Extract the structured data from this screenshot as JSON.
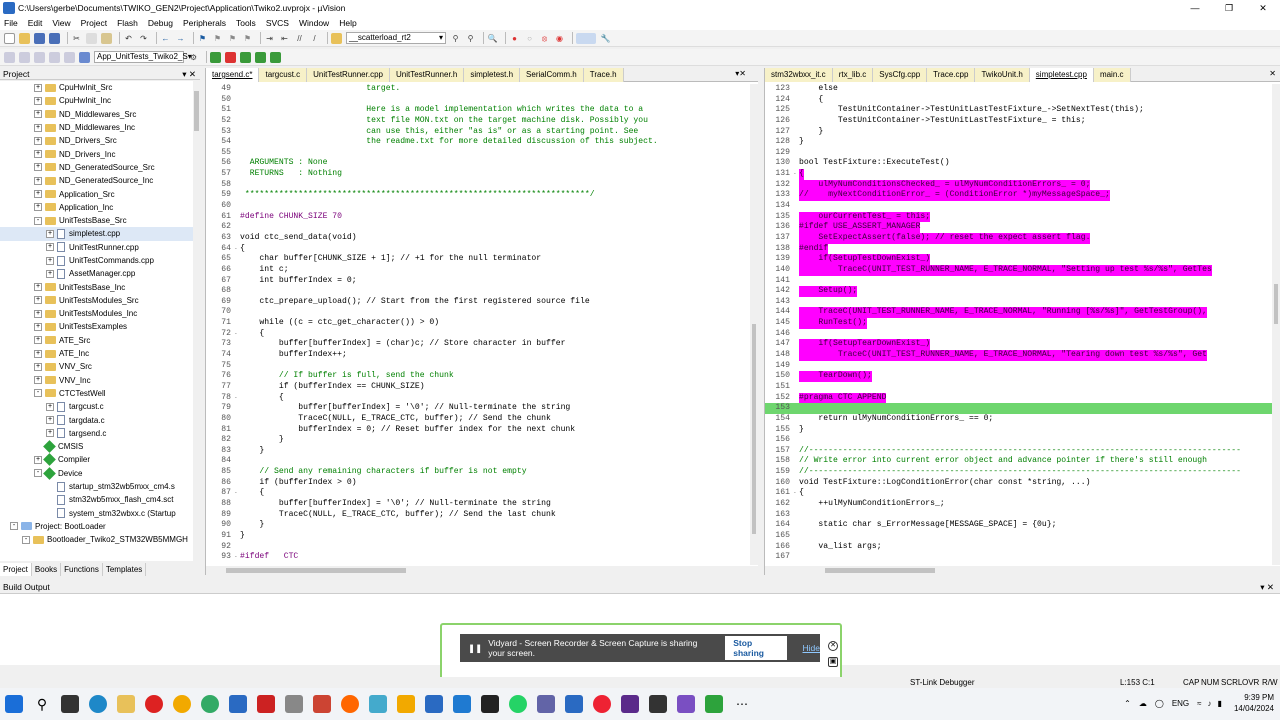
{
  "window": {
    "title": "C:\\Users\\gerbe\\Documents\\TWIKO_GEN2\\Project\\Application\\Twiko2.uvprojx - µVision"
  },
  "menu": [
    "File",
    "Edit",
    "View",
    "Project",
    "Flash",
    "Debug",
    "Peripherals",
    "Tools",
    "SVCS",
    "Window",
    "Help"
  ],
  "toolbar": {
    "target_combo": "__scatterload_rt2",
    "project_combo": "App_UnitTests_Twiko2_S"
  },
  "project_panel": {
    "title": "Project",
    "items": [
      {
        "label": "CpuHwInit_Src",
        "depth": 3,
        "type": "folder",
        "exp": "+"
      },
      {
        "label": "CpuHwInit_Inc",
        "depth": 3,
        "type": "folder",
        "exp": "+"
      },
      {
        "label": "ND_Middlewares_Src",
        "depth": 3,
        "type": "folder",
        "exp": "+"
      },
      {
        "label": "ND_Middlewares_Inc",
        "depth": 3,
        "type": "folder",
        "exp": "+"
      },
      {
        "label": "ND_Drivers_Src",
        "depth": 3,
        "type": "folder",
        "exp": "+"
      },
      {
        "label": "ND_Drivers_Inc",
        "depth": 3,
        "type": "folder",
        "exp": "+"
      },
      {
        "label": "ND_GeneratedSource_Src",
        "depth": 3,
        "type": "folder",
        "exp": "+"
      },
      {
        "label": "ND_GeneratedSource_Inc",
        "depth": 3,
        "type": "folder",
        "exp": "+"
      },
      {
        "label": "Application_Src",
        "depth": 3,
        "type": "folder",
        "exp": "+"
      },
      {
        "label": "Application_Inc",
        "depth": 3,
        "type": "folder",
        "exp": "+"
      },
      {
        "label": "UnitTestsBase_Src",
        "depth": 3,
        "type": "folder",
        "exp": "-"
      },
      {
        "label": "simpletest.cpp",
        "depth": 4,
        "type": "file",
        "exp": "+",
        "sel": true
      },
      {
        "label": "UnitTestRunner.cpp",
        "depth": 4,
        "type": "file",
        "exp": "+"
      },
      {
        "label": "UnitTestCommands.cpp",
        "depth": 4,
        "type": "file",
        "exp": "+"
      },
      {
        "label": "AssetManager.cpp",
        "depth": 4,
        "type": "file",
        "exp": "+"
      },
      {
        "label": "UnitTestsBase_Inc",
        "depth": 3,
        "type": "folder",
        "exp": "+"
      },
      {
        "label": "UnitTestsModules_Src",
        "depth": 3,
        "type": "folder",
        "exp": "+"
      },
      {
        "label": "UnitTestsModules_Inc",
        "depth": 3,
        "type": "folder",
        "exp": "+"
      },
      {
        "label": "UnitTestsExamples",
        "depth": 3,
        "type": "folder",
        "exp": "+"
      },
      {
        "label": "ATE_Src",
        "depth": 3,
        "type": "folder",
        "exp": "+"
      },
      {
        "label": "ATE_Inc",
        "depth": 3,
        "type": "folder",
        "exp": "+"
      },
      {
        "label": "VNV_Src",
        "depth": 3,
        "type": "folder",
        "exp": "+"
      },
      {
        "label": "VNV_Inc",
        "depth": 3,
        "type": "folder",
        "exp": "+"
      },
      {
        "label": "CTCTestWell",
        "depth": 3,
        "type": "folder",
        "exp": "-"
      },
      {
        "label": "targcust.c",
        "depth": 4,
        "type": "file",
        "exp": "+"
      },
      {
        "label": "targdata.c",
        "depth": 4,
        "type": "file",
        "exp": "+"
      },
      {
        "label": "targsend.c",
        "depth": 4,
        "type": "file",
        "exp": "+"
      },
      {
        "label": "CMSIS",
        "depth": 3,
        "type": "gem",
        "exp": ""
      },
      {
        "label": "Compiler",
        "depth": 3,
        "type": "gem",
        "exp": "+"
      },
      {
        "label": "Device",
        "depth": 3,
        "type": "gem",
        "exp": "-"
      },
      {
        "label": "startup_stm32wb5mxx_cm4.s",
        "depth": 4,
        "type": "file",
        "exp": ""
      },
      {
        "label": "stm32wb5mxx_flash_cm4.sct",
        "depth": 4,
        "type": "file",
        "exp": ""
      },
      {
        "label": "system_stm32wbxx.c (Startup",
        "depth": 4,
        "type": "file",
        "exp": ""
      },
      {
        "label": "Project: BootLoader",
        "depth": 1,
        "type": "proj",
        "exp": "-"
      },
      {
        "label": "Bootloader_Twiko2_STM32WB5MMGH",
        "depth": 2,
        "type": "folder",
        "exp": "-"
      }
    ],
    "tabs": [
      "Project",
      "Books",
      "Functions",
      "Templates"
    ]
  },
  "left_editor": {
    "tabs": [
      "targsend.c*",
      "targcust.c",
      "UnitTestRunner.cpp",
      "UnitTestRunner.h",
      "simpletest.h",
      "SerialComm.h",
      "Trace.h"
    ],
    "lines": [
      {
        "n": "49",
        "g": "",
        "html": "                          target."
      },
      {
        "n": "50",
        "g": "",
        "html": ""
      },
      {
        "n": "51",
        "g": "",
        "html": "                          Here is a model implementation which writes the data to a"
      },
      {
        "n": "52",
        "g": "",
        "html": "                          text file MON.txt on the target machine disk. Possibly you"
      },
      {
        "n": "53",
        "g": "",
        "html": "                          can use this, either \"as is\" or as a starting point. See"
      },
      {
        "n": "54",
        "g": "",
        "html": "                          the readme.txt for more detailed discussion of this subject."
      },
      {
        "n": "55",
        "g": "",
        "html": ""
      },
      {
        "n": "56",
        "g": "",
        "html": "  ARGUMENTS : None"
      },
      {
        "n": "57",
        "g": "",
        "html": "  RETURNS   : Nothing"
      },
      {
        "n": "58",
        "g": "",
        "html": ""
      },
      {
        "n": "59",
        "g": "",
        "html": " ***********************************************************************/"
      },
      {
        "n": "60",
        "g": "",
        "html": ""
      },
      {
        "n": "61",
        "g": "",
        "html": "#define CHUNK_SIZE 70",
        "cls": "pp"
      },
      {
        "n": "62",
        "g": "",
        "html": ""
      },
      {
        "n": "63",
        "g": "",
        "html": "void ctc_send_data(void)"
      },
      {
        "n": "64",
        "g": "-",
        "html": "{"
      },
      {
        "n": "65",
        "g": "",
        "html": "    char buffer[CHUNK_SIZE + 1]; // +1 for the null terminator"
      },
      {
        "n": "66",
        "g": "",
        "html": "    int c;"
      },
      {
        "n": "67",
        "g": "",
        "html": "    int bufferIndex = 0;"
      },
      {
        "n": "68",
        "g": "",
        "html": ""
      },
      {
        "n": "69",
        "g": "",
        "html": "    ctc_prepare_upload(); // Start from the first registered source file"
      },
      {
        "n": "70",
        "g": "",
        "html": ""
      },
      {
        "n": "71",
        "g": "",
        "html": "    while ((c = ctc_get_character()) > 0)"
      },
      {
        "n": "72",
        "g": "-",
        "html": "    {"
      },
      {
        "n": "73",
        "g": "",
        "html": "        buffer[bufferIndex] = (char)c; // Store character in buffer"
      },
      {
        "n": "74",
        "g": "",
        "html": "        bufferIndex++;"
      },
      {
        "n": "75",
        "g": "",
        "html": ""
      },
      {
        "n": "76",
        "g": "",
        "html": "        // If buffer is full, send the chunk"
      },
      {
        "n": "77",
        "g": "",
        "html": "        if (bufferIndex == CHUNK_SIZE)"
      },
      {
        "n": "78",
        "g": "-",
        "html": "        {"
      },
      {
        "n": "79",
        "g": "",
        "html": "            buffer[bufferIndex] = '\\0'; // Null-terminate the string"
      },
      {
        "n": "80",
        "g": "",
        "html": "            TraceC(NULL, E_TRACE_CTC, buffer); // Send the chunk"
      },
      {
        "n": "81",
        "g": "",
        "html": "            bufferIndex = 0; // Reset buffer index for the next chunk"
      },
      {
        "n": "82",
        "g": "",
        "html": "        }"
      },
      {
        "n": "83",
        "g": "",
        "html": "    }"
      },
      {
        "n": "84",
        "g": "",
        "html": ""
      },
      {
        "n": "85",
        "g": "",
        "html": "    // Send any remaining characters if buffer is not empty"
      },
      {
        "n": "86",
        "g": "",
        "html": "    if (bufferIndex > 0)"
      },
      {
        "n": "87",
        "g": "-",
        "html": "    {"
      },
      {
        "n": "88",
        "g": "",
        "html": "        buffer[bufferIndex] = '\\0'; // Null-terminate the string"
      },
      {
        "n": "89",
        "g": "",
        "html": "        TraceC(NULL, E_TRACE_CTC, buffer); // Send the last chunk"
      },
      {
        "n": "90",
        "g": "",
        "html": "    }"
      },
      {
        "n": "91",
        "g": "",
        "html": "}"
      },
      {
        "n": "92",
        "g": "",
        "html": ""
      },
      {
        "n": "93",
        "g": "-",
        "html": "#ifdef   CTC"
      }
    ]
  },
  "right_editor": {
    "tabs": [
      "stm32wbxx_it.c",
      "rtx_lib.c",
      "SysCfg.cpp",
      "Trace.cpp",
      "TwikoUnit.h",
      "simpletest.cpp",
      "main.c"
    ],
    "lines": [
      {
        "n": "123",
        "g": "",
        "html": "    else"
      },
      {
        "n": "124",
        "g": "",
        "html": "    {"
      },
      {
        "n": "125",
        "g": "",
        "html": "        TestUnitContainer->TestUnitLastTestFixture_->SetNextTest(this);"
      },
      {
        "n": "126",
        "g": "",
        "html": "        TestUnitContainer->TestUnitLastTestFixture_ = this;"
      },
      {
        "n": "127",
        "g": "",
        "html": "    }"
      },
      {
        "n": "128",
        "g": "",
        "html": "}"
      },
      {
        "n": "129",
        "g": "",
        "html": ""
      },
      {
        "n": "130",
        "g": "",
        "html": "bool TestFixture::ExecuteTest()"
      },
      {
        "n": "131",
        "g": "-",
        "html": "{",
        "m": "mag"
      },
      {
        "n": "132",
        "g": "",
        "html": "    ulMyNumConditionsChecked_ = ulMyNumConditionErrors_ = 0;",
        "m": "mag"
      },
      {
        "n": "133",
        "g": "",
        "html": "//    myNextConditionError_ = (ConditionError *)myMessageSpace_;",
        "m": "mag"
      },
      {
        "n": "134",
        "g": "",
        "html": ""
      },
      {
        "n": "135",
        "g": "",
        "html": "    ourCurrentTest_ = this;",
        "m": "mag"
      },
      {
        "n": "136",
        "g": "",
        "html": "#ifdef USE_ASSERT_MANAGER",
        "m": "mag"
      },
      {
        "n": "137",
        "g": "",
        "html": "    SetExpectAssert(false); // reset the expect assert flag.",
        "m": "mag"
      },
      {
        "n": "138",
        "g": "",
        "html": "#endif",
        "m": "mag"
      },
      {
        "n": "139",
        "g": "",
        "html": "    if(SetupTestDownExist_)",
        "m": "mag"
      },
      {
        "n": "140",
        "g": "",
        "html": "        TraceC(UNIT_TEST_RUNNER_NAME, E_TRACE_NORMAL, \"Setting up test %s/%s\", GetTes",
        "m": "mag"
      },
      {
        "n": "141",
        "g": "",
        "html": ""
      },
      {
        "n": "142",
        "g": "",
        "html": "    Setup();",
        "m": "mag"
      },
      {
        "n": "143",
        "g": "",
        "html": ""
      },
      {
        "n": "144",
        "g": "",
        "html": "    TraceC(UNIT_TEST_RUNNER_NAME, E_TRACE_NORMAL, \"Running [%s/%s]\", GetTestGroup(),",
        "m": "mag"
      },
      {
        "n": "145",
        "g": "",
        "html": "    RunTest();",
        "m": "mag"
      },
      {
        "n": "146",
        "g": "",
        "html": ""
      },
      {
        "n": "147",
        "g": "",
        "html": "    if(SetupTearDownExist_)",
        "m": "mag"
      },
      {
        "n": "148",
        "g": "",
        "html": "        TraceC(UNIT_TEST_RUNNER_NAME, E_TRACE_NORMAL, \"Tearing down test %s/%s\", Get",
        "m": "mag"
      },
      {
        "n": "149",
        "g": "",
        "html": ""
      },
      {
        "n": "150",
        "g": "",
        "html": "    TearDown();",
        "m": "mag"
      },
      {
        "n": "151",
        "g": "",
        "html": ""
      },
      {
        "n": "152",
        "g": "",
        "html": "#pragma CTC APPEND",
        "m": "mag"
      },
      {
        "n": "153",
        "g": "",
        "html": "",
        "m": "grn"
      },
      {
        "n": "154",
        "g": "",
        "html": "    return ulMyNumConditionErrors_ == 0;"
      },
      {
        "n": "155",
        "g": "",
        "html": "}"
      },
      {
        "n": "156",
        "g": "",
        "html": ""
      },
      {
        "n": "157",
        "g": "",
        "html": "//-----------------------------------------------------------------------------------------"
      },
      {
        "n": "158",
        "g": "",
        "html": "// Write error into current error object and advance pointer if there's still enough"
      },
      {
        "n": "159",
        "g": "",
        "html": "//-----------------------------------------------------------------------------------------"
      },
      {
        "n": "160",
        "g": "",
        "html": "void TestFixture::LogConditionError(char const *string, ...)"
      },
      {
        "n": "161",
        "g": "-",
        "html": "{"
      },
      {
        "n": "162",
        "g": "",
        "html": "    ++ulMyNumConditionErrors_;"
      },
      {
        "n": "163",
        "g": "",
        "html": ""
      },
      {
        "n": "164",
        "g": "",
        "html": "    static char s_ErrorMessage[MESSAGE_SPACE] = {0u};"
      },
      {
        "n": "165",
        "g": "",
        "html": ""
      },
      {
        "n": "166",
        "g": "",
        "html": "    va_list args;"
      },
      {
        "n": "167",
        "g": "",
        "html": ""
      }
    ]
  },
  "build": {
    "title": "Build Output"
  },
  "share_popup": {
    "message": "Vidyard - Screen Recorder & Screen Capture is sharing your screen.",
    "stop": "Stop sharing",
    "hide": "Hide"
  },
  "status": {
    "debugger": "ST-Link Debugger",
    "position": "L:153 C:1",
    "caps": "CAP",
    "num": "NUM",
    "scrl": "SCRL",
    "ovr": "OVR",
    "rw": "R/W"
  },
  "taskbar": {
    "lang": "ENG",
    "time": "9:39 PM",
    "date": "14/04/2024"
  }
}
